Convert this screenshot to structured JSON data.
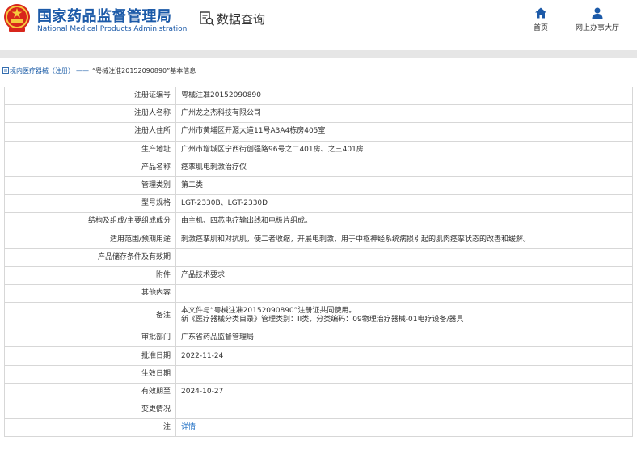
{
  "header": {
    "site_name_cn": "国家药品监督管理局",
    "site_name_en": "National Medical Products Administration",
    "search_label": "数据查询",
    "nav": [
      {
        "label": "首页",
        "icon": "home-icon"
      },
      {
        "label": "网上办事大厅",
        "icon": "user-icon"
      }
    ]
  },
  "breadcrumb": {
    "section": "境内医疗器械（注册）",
    "separator": "——",
    "current": "“粤械注准20152090890”基本信息"
  },
  "colors": {
    "brand_blue": "#1c5aa8",
    "link_blue": "#1f6fc4",
    "border": "#d7d7d7",
    "divider": "#e6e6e6"
  },
  "detail": {
    "rows": [
      {
        "key": "注册证编号",
        "value": "粤械注准20152090890"
      },
      {
        "key": "注册人名称",
        "value": "广州龙之杰科技有限公司"
      },
      {
        "key": "注册人住所",
        "value": "广州市黄埔区开源大道11号A3A4栋房405室"
      },
      {
        "key": "生产地址",
        "value": "广州市增城区宁西街创强路96号之二401房、之三401房"
      },
      {
        "key": "产品名称",
        "value": "痉挛肌电刺激治疗仪"
      },
      {
        "key": "管理类别",
        "value": "第二类"
      },
      {
        "key": "型号规格",
        "value": "LGT-2330B、LGT-2330D"
      },
      {
        "key": "结构及组成/主要组成成分",
        "value": "由主机、四芯电疗输出线和电极片组成。"
      },
      {
        "key": "适用范围/预期用途",
        "value": "刺激痉挛肌和对抗肌，使二者收缩，开展电刺激，用于中枢神经系统病损引起的肌肉痉挛状态的改善和缓解。"
      },
      {
        "key": "产品储存条件及有效期",
        "value": ""
      },
      {
        "key": "附件",
        "value": "产品技术要求"
      },
      {
        "key": "其他内容",
        "value": ""
      },
      {
        "key": "备注",
        "value": "本文件与“粤械注准20152090890”注册证共同使用。",
        "value2": "新《医疗器械分类目录》管理类别：II类，分类编码：09物理治疗器械-01电疗设备/器具"
      },
      {
        "key": "审批部门",
        "value": "广东省药品监督管理局"
      },
      {
        "key": "批准日期",
        "value": "2022-11-24"
      },
      {
        "key": "生效日期",
        "value": ""
      },
      {
        "key": "有效期至",
        "value": "2024-10-27"
      },
      {
        "key": "变更情况",
        "value": ""
      },
      {
        "key": "注",
        "value": "详情"
      }
    ]
  }
}
